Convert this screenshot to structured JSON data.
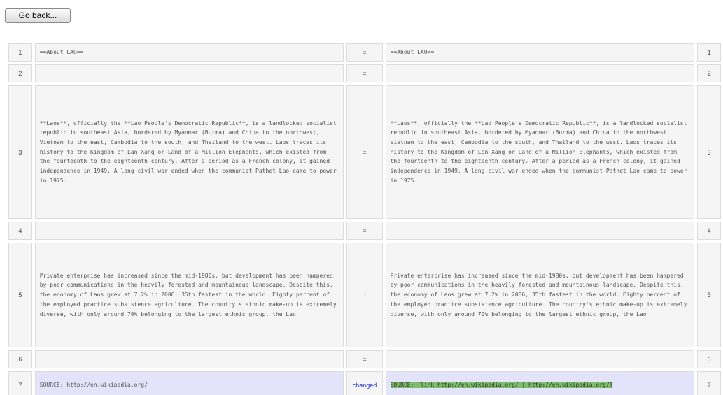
{
  "toolbar": {
    "go_back_label": "Go back..."
  },
  "rows": [
    {
      "left_num": "1",
      "left_text": "==About LAO==",
      "status": "=",
      "right_num": "1",
      "right_text": "==About LAO=="
    },
    {
      "left_num": "2",
      "left_text": "",
      "status": "=",
      "right_num": "2",
      "right_text": ""
    },
    {
      "left_num": "3",
      "left_text": "**Laos**, officially the **Lao People's Democratic Republic**, is a landlocked socialist republic in southeast Asia, bordered by Myanmar (Burma) and China to the northwest, Vietnam to the east, Cambodia to the south, and Thailand to the west. Laos traces its history to the Kingdom of Lan Xang or Land of a Million Elephants, which existed from the fourteenth to the eighteenth century. After a period as a French colony, it gained independence in 1949. A long civil war ended when the communist Pathet Lao came to power in 1975.",
      "status": "=",
      "right_num": "3",
      "right_text": "**Laos**, officially the **Lao People's Democratic Republic**, is a landlocked socialist republic in southeast Asia, bordered by Myanmar (Burma) and China to the northwest, Vietnam to the east, Cambodia to the south, and Thailand to the west. Laos traces its history to the Kingdom of Lan Xang or Land of a Million Elephants, which existed from the fourteenth to the eighteenth century. After a period as a French colony, it gained independence in 1949. A long civil war ended when the communist Pathet Lao came to power in 1975."
    },
    {
      "left_num": "4",
      "left_text": "",
      "status": "=",
      "right_num": "4",
      "right_text": ""
    },
    {
      "left_num": "5",
      "left_text": "Private enterprise has increased since the mid-1980s, but development has been hampered by poor communications in the heavily forested and mountainous landscape. Despite this, the economy of Laos grew at 7.2% in 2006, 35th fastest in the world. Eighty percent of the employed practice subsistence agriculture. The country's ethnic make-up is extremely diverse, with only around 70% belonging to the largest ethnic group, the Lao",
      "status": "=",
      "right_num": "5",
      "right_text": "Private enterprise has increased since the mid-1980s, but development has been hampered by poor communications in the heavily forested and mountainous landscape. Despite this, the economy of Laos grew at 7.2% in 2006, 35th fastest in the world. Eighty percent of the employed practice subsistence agriculture. The country's ethnic make-up is extremely diverse, with only around 70% belonging to the largest ethnic group, the Lao"
    },
    {
      "left_num": "6",
      "left_text": "",
      "status": "=",
      "right_num": "6",
      "right_text": ""
    },
    {
      "left_num": "7",
      "left_text": "SOURCE: http://en.wikipedia.org/",
      "status": "changed",
      "right_num": "7",
      "right_text": "SOURCE: [link http://en.wikipedia.org/ | http://en.wikipedia.org/]"
    }
  ],
  "colors": {
    "changed_row_bg": "#e3e3f9",
    "changed_label": "#1b33c9",
    "new_text_highlight": "#7dbf6a",
    "cell_bg": "#f5f5f5"
  }
}
